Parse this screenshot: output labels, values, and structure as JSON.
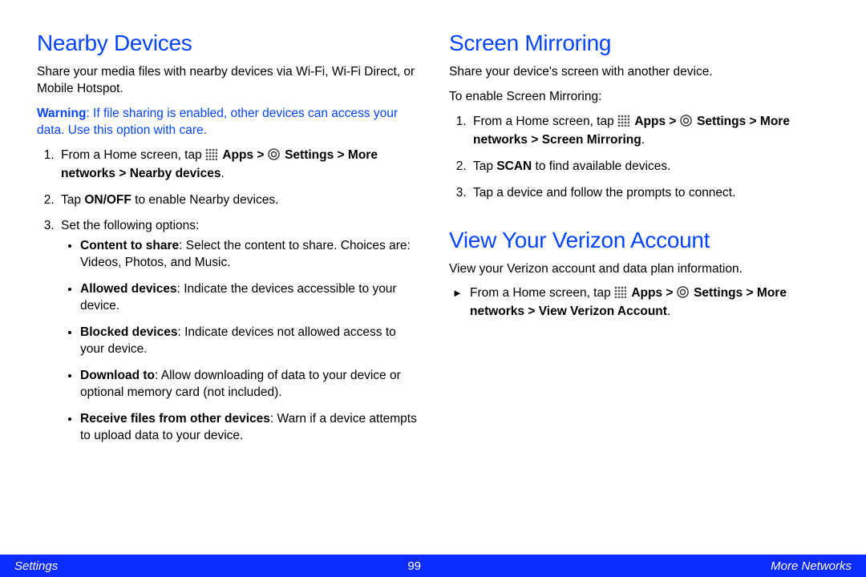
{
  "left": {
    "heading": "Nearby Devices",
    "intro": "Share your media files with nearby devices via Wi-Fi, Wi-Fi Direct, or Mobile Hotspot.",
    "warning_label": "Warning",
    "warning_text": ": If file sharing is enabled, other devices can access your data. Use this option with care.",
    "step1_prefix": "From a Home screen, tap ",
    "apps": "Apps",
    "gt": " > ",
    "settings": "Settings",
    "path_tail": "More networks > Nearby devices",
    "step2_a": "Tap ",
    "step2_b": "ON/OFF",
    "step2_c": " to enable Nearby devices.",
    "step3": "Set the following options:",
    "opt1_b": "Content to share",
    "opt1_r": ": Select the content to share. Choices are: Videos, Photos, and Music.",
    "opt2_b": "Allowed devices",
    "opt2_r": ": Indicate the devices accessible to your device.",
    "opt3_b": "Blocked devices",
    "opt3_r": ": Indicate devices not allowed access to your device.",
    "opt4_b": "Download to",
    "opt4_r": ": Allow downloading of data to your device or optional memory card (not included).",
    "opt5_b": "Receive files from other devices",
    "opt5_r": ": Warn if a device attempts to upload data to your device."
  },
  "right": {
    "sm_heading": "Screen Mirroring",
    "sm_intro": "Share your device's screen with another device.",
    "sm_enable": "To enable Screen Mirroring:",
    "sm_step1_prefix": "From a Home screen, tap ",
    "sm_path_tail": "More networks > Screen Mirroring",
    "sm_step2_a": "Tap ",
    "sm_step2_b": "SCAN",
    "sm_step2_c": " to find available devices.",
    "sm_step3": "Tap a device and follow the prompts to connect.",
    "vz_heading": "View Your Verizon Account",
    "vz_intro": "View your Verizon account and data plan information.",
    "vz_step_prefix": "From a Home screen, tap ",
    "vz_path_tail": "More networks > View Verizon Account"
  },
  "footer": {
    "left": "Settings",
    "center": "99",
    "right": "More Networks"
  },
  "period": "."
}
